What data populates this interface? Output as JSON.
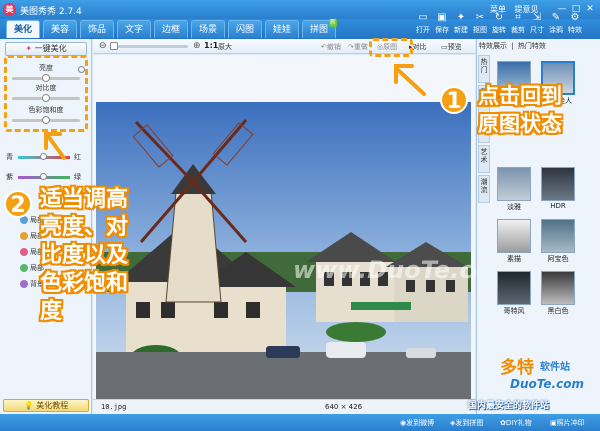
{
  "window": {
    "title": "美图秀秀 2.7.4",
    "links": [
      "菜单",
      "提意见"
    ],
    "buttons": [
      "—",
      "□",
      "✕"
    ]
  },
  "tabs": [
    {
      "label": "美化",
      "active": true
    },
    {
      "label": "美容"
    },
    {
      "label": "饰品"
    },
    {
      "label": "文字"
    },
    {
      "label": "边框"
    },
    {
      "label": "场景"
    },
    {
      "label": "闪图"
    },
    {
      "label": "娃娃"
    },
    {
      "label": "拼图",
      "badge": "新"
    }
  ],
  "top_toolbar": [
    {
      "icon": "folder-open-icon",
      "label": "打开"
    },
    {
      "icon": "save-icon",
      "label": "保存"
    },
    {
      "icon": "new-icon",
      "label": "新建"
    },
    {
      "icon": "crop-icon",
      "label": "抠图"
    },
    {
      "icon": "rotate-icon",
      "label": "旋转"
    },
    {
      "icon": "cut-icon",
      "label": "裁剪"
    },
    {
      "icon": "resize-icon",
      "label": "尺寸"
    },
    {
      "icon": "brush-icon",
      "label": "涂鸦"
    },
    {
      "icon": "ruler-icon",
      "label": "特效"
    }
  ],
  "left_panel": {
    "onekey_label": "一键美化",
    "sliders": [
      {
        "label": "亮度"
      },
      {
        "label": "对比度"
      },
      {
        "label": "色彩饱和度"
      }
    ],
    "color_sliders": [
      {
        "left": "青",
        "right": "红"
      },
      {
        "left": "紫",
        "right": "绿"
      }
    ],
    "effects": [
      "局部",
      "局部",
      "局部",
      "局部",
      "背景"
    ],
    "tutorial_label": "美化教程"
  },
  "canvas_toolbar": {
    "zoom_ratio": "1:1",
    "orig_label": "原大",
    "undo": "撤销",
    "redo": "重做",
    "original": "原图",
    "compare": "对比",
    "preview": "预览"
  },
  "canvas": {
    "filename": "10.jpg",
    "dims": "640 × 426",
    "watermark": "www.DuoTe.com"
  },
  "right_panel": {
    "tabs": [
      "特效展示",
      "|",
      "热门特效"
    ],
    "side_tabs": [
      "热门",
      "基础",
      "时尚",
      "艺术",
      "潮流"
    ],
    "thumbnails": [
      {
        "label": "复古LOMO",
        "color": "#6b8aa6"
      },
      {
        "label": "粉红佳人",
        "color": "#9bb3c9"
      },
      {
        "label": "淡雅",
        "color": "#9ab0c3"
      },
      {
        "label": "HDR",
        "color": "#5d6b7a"
      },
      {
        "label": "素描",
        "color": "#c7c7c7"
      },
      {
        "label": "阿宝色",
        "color": "#6e8a9a"
      },
      {
        "label": "哥特风",
        "color": "#3f4a55"
      },
      {
        "label": "黑白色",
        "color": "#8c8c8c"
      }
    ]
  },
  "annotations": {
    "step1_number": "1",
    "step1_text_line1": "点击回到",
    "step1_text_line2": "原图状态",
    "step2_number": "2",
    "step2_lines": [
      "适当调高",
      "亮度、对",
      "比度以及",
      "色彩饱和",
      "度"
    ]
  },
  "site_watermark": {
    "brand": "多特",
    "sub": "软件站",
    "url": "DuoTe.com",
    "tagline": "国内最安全的软件站"
  },
  "status_bar": [
    "发到微博",
    "发到拼图",
    "DIY礼物",
    "照片冲印"
  ],
  "colors": {
    "accent_orange": "#f5a012",
    "title_blue": "#2a7fcd"
  }
}
